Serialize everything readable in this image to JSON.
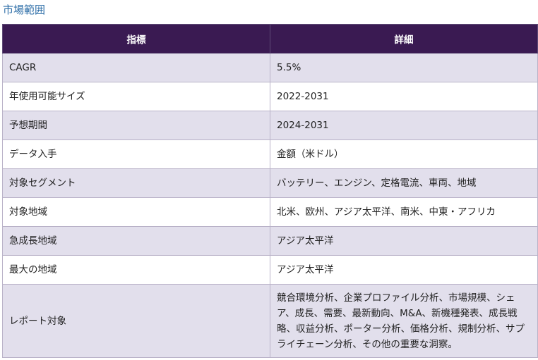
{
  "title": "市場範囲",
  "table": {
    "headers": [
      "指標",
      "詳細"
    ],
    "rows": [
      {
        "metric": "CAGR",
        "detail": "5.5%"
      },
      {
        "metric": "年使用可能サイズ",
        "detail": "2022-2031"
      },
      {
        "metric": "予想期間",
        "detail": "2024-2031"
      },
      {
        "metric": "データ入手",
        "detail": "金額（米ドル）"
      },
      {
        "metric": "対象セグメント",
        "detail": "バッテリー、エンジン、定格電流、車両、地域"
      },
      {
        "metric": "対象地域",
        "detail": "北米、欧州、アジア太平洋、南米、中東・アフリカ"
      },
      {
        "metric": "急成長地域",
        "detail": "アジア太平洋"
      },
      {
        "metric": "最大の地域",
        "detail": "アジア太平洋"
      },
      {
        "metric": "レポート対象",
        "detail": "競合環境分析、企業プロファイル分析、市場規模、シェア、成長、需要、最新動向、M&A、新機種発表、成長戦略、収益分析、ポーター分析、価格分析、規制分析、サプライチェーン分析、その他の重要な洞察。"
      }
    ]
  }
}
